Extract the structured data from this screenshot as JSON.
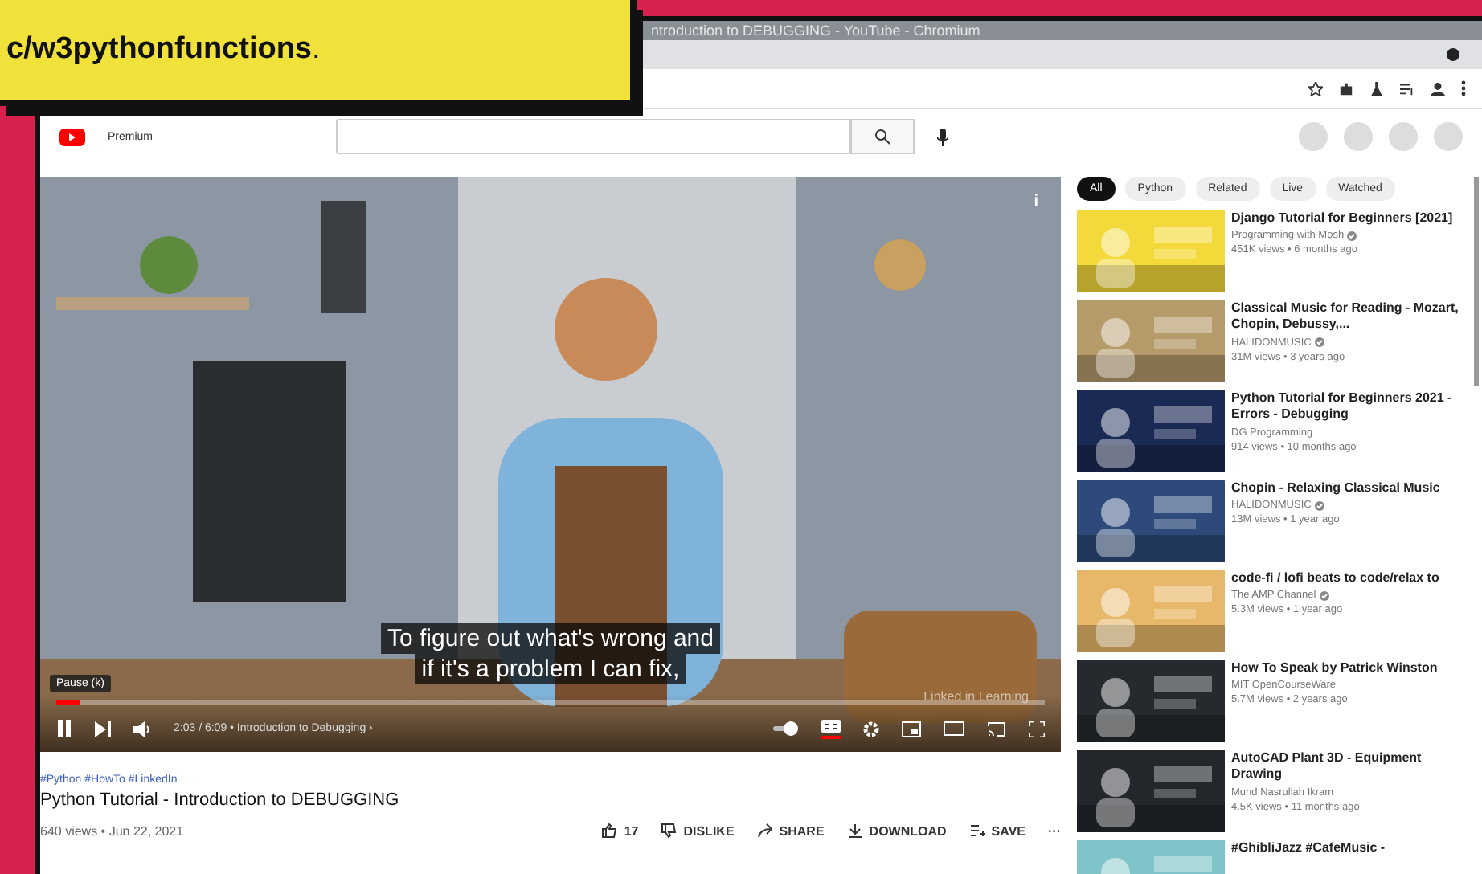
{
  "callout": {
    "text": "**c/w3pythonfunctions**."
  },
  "window": {
    "title": "ntroduction to DEBUGGING - YouTube - Chromium"
  },
  "header": {
    "logo_text": "Premium"
  },
  "video": {
    "info_button": "i",
    "captions": [
      "To figure out what's wrong and",
      "if it's a problem I can fix,"
    ],
    "tooltip": "Pause (k)",
    "progress": {
      "level": 0.025
    },
    "time": "2:03 / 6:09 • Introduction to Debugging ›",
    "watermark": "Linked in Learning",
    "captions_on": true
  },
  "hashtags": "#Python #HowTo #LinkedIn",
  "title": "Python Tutorial - Introduction to DEBUGGING",
  "meta": "640 views • Jun 22, 2021",
  "actions": [
    {
      "kind": "like",
      "label": "17"
    },
    {
      "kind": "dislike",
      "label": "DISLIKE"
    },
    {
      "kind": "share",
      "label": "SHARE"
    },
    {
      "kind": "download",
      "label": "DOWNLOAD"
    },
    {
      "kind": "save",
      "label": "SAVE"
    },
    {
      "kind": "more",
      "label": "···"
    }
  ],
  "chips": [
    {
      "label": "All",
      "selected": true
    },
    {
      "label": "Python",
      "selected": false
    },
    {
      "label": "Related",
      "selected": false
    },
    {
      "label": "Live",
      "selected": false
    },
    {
      "label": "Watched",
      "selected": false
    }
  ],
  "recommendations": [
    {
      "title": "Django Tutorial for Beginners [2021]",
      "channel": "Programming with Mosh",
      "verified": true,
      "meta": "451K views • 6 months ago"
    },
    {
      "title": "Classical Music for Reading - Mozart, Chopin, Debussy,...",
      "channel": "HALIDONMUSIC",
      "verified": true,
      "meta": "31M views • 3 years ago"
    },
    {
      "title": "Python Tutorial for Beginners 2021 - Errors - Debugging",
      "channel": "DG Programming",
      "verified": false,
      "meta": "914 views • 10 months ago"
    },
    {
      "title": "Chopin - Relaxing Classical Music",
      "channel": "HALIDONMUSIC",
      "verified": true,
      "meta": "13M views • 1 year ago"
    },
    {
      "title": "code-fi / lofi beats to code/relax to",
      "channel": "The AMP Channel",
      "verified": true,
      "meta": "5.3M views • 1 year ago"
    },
    {
      "title": "How To Speak by Patrick Winston",
      "channel": "MIT OpenCourseWare",
      "verified": false,
      "meta": "5.7M views • 2 years ago"
    },
    {
      "title": "AutoCAD Plant 3D - Equipment Drawing",
      "channel": "Muhd Nasrullah Ikram",
      "verified": false,
      "meta": "4.5K views • 11 months ago"
    },
    {
      "title": "#GhibliJazz #CafeMusic -"
    }
  ]
}
